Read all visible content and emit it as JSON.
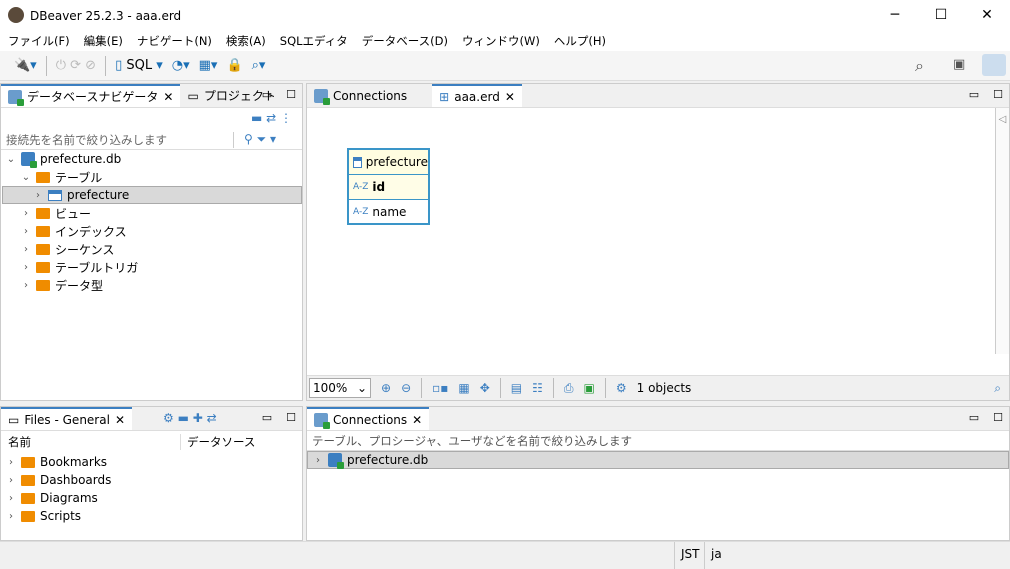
{
  "window": {
    "title": "DBeaver 25.2.3 - aaa.erd",
    "minimize": "─",
    "maximize": "☐",
    "close": "✕"
  },
  "menu": [
    "ファイル(F)",
    "編集(E)",
    "ナビゲート(N)",
    "検索(A)",
    "SQLエディタ",
    "データベース(D)",
    "ウィンドウ(W)",
    "ヘルプ(H)"
  ],
  "toolbar": {
    "sql_label": "SQL"
  },
  "navigator": {
    "tabs": [
      "データベースナビゲータ",
      "プロジェクト"
    ],
    "filter_placeholder": "接続先を名前で絞り込みします",
    "tree": {
      "db": "prefecture.db",
      "tables": "テーブル",
      "table": "prefecture",
      "folders": [
        "ビュー",
        "インデックス",
        "シーケンス",
        "テーブルトリガ",
        "データ型"
      ]
    }
  },
  "editor": {
    "tabs": [
      "Connections",
      "aaa.erd"
    ],
    "entity": {
      "name": "prefecture",
      "columns": [
        {
          "type": "A-Z",
          "name": "id"
        },
        {
          "type": "A-Z",
          "name": "name"
        }
      ]
    },
    "zoom": "100%",
    "objects": "1 objects"
  },
  "files": {
    "tab": "Files - General",
    "columns": [
      "名前",
      "データソース"
    ],
    "items": [
      "Bookmarks",
      "Dashboards",
      "Diagrams",
      "Scripts"
    ]
  },
  "connections": {
    "tab": "Connections",
    "filter_placeholder": "テーブル、プロシージャ、ユーザなどを名前で絞り込みします",
    "item": "prefecture.db"
  },
  "status": {
    "tz": "JST",
    "locale": "ja"
  }
}
